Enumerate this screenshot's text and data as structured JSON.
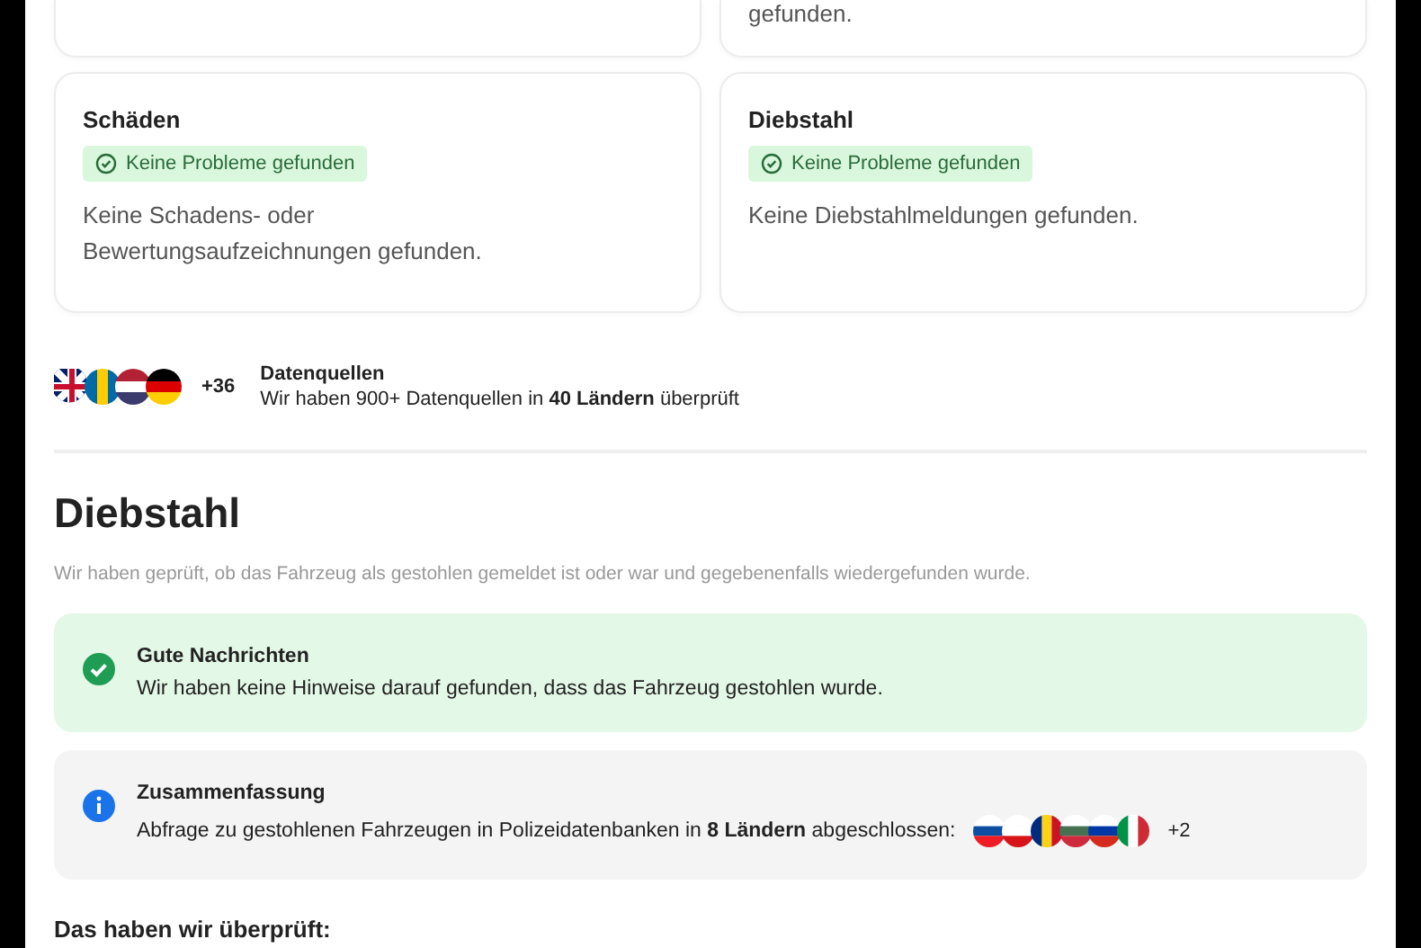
{
  "top_card_right": {
    "text": "gefunden."
  },
  "cards": [
    {
      "title": "Schäden",
      "badge": "Keine Probleme gefunden",
      "text": "Keine Schadens- oder Bewertungsaufzeichnungen gefunden."
    },
    {
      "title": "Diebstahl",
      "badge": "Keine Probleme gefunden",
      "text": "Keine Diebstahlmeldungen gefunden."
    }
  ],
  "sources": {
    "more": "+36",
    "title": "Datenquellen",
    "text": "Wir haben 900+ Datenquellen in **40 Ländern** überprüft"
  },
  "section": {
    "title": "Diebstahl",
    "subtitle": "Wir haben geprüft, ob das Fahrzeug als gestohlen gemeldet ist oder war und gegebenenfalls wiedergefunden wurde."
  },
  "notices": [
    {
      "kind": "success",
      "title": "Gute Nachrichten",
      "text": "Wir haben keine Hinweise darauf gefunden, dass das Fahrzeug gestohlen wurde."
    },
    {
      "kind": "info",
      "title": "Zusammenfassung",
      "text": "Abfrage zu gestohlenen Fahrzeugen in Polizeidatenbanken in **8 Ländern** abgeschlossen:",
      "more": "+2"
    }
  ],
  "checked_heading": "Das haben wir überprüft:"
}
